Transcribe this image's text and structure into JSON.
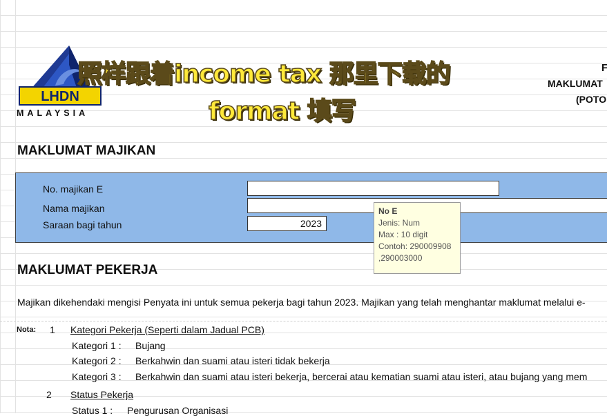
{
  "overlay": {
    "line1": "照样跟着income tax 那里下载的",
    "line2": "format 填写"
  },
  "logo": {
    "name": "LHDN",
    "country": "MALAYSIA"
  },
  "header_right": {
    "line1": "F",
    "line2": "MAKLUMAT",
    "line3": "(POTO"
  },
  "majikan": {
    "title": "MAKLUMAT MAJIKAN",
    "no_majikan_label": "No. majikan E",
    "nama_majikan_label": "Nama majikan",
    "saraan_label": "Saraan bagi tahun",
    "no_majikan_value": "",
    "nama_majikan_value": "",
    "saraan_value": "2023"
  },
  "tooltip": {
    "title": "No E",
    "line1": "Jenis: Num",
    "line2": "Max : 10 digit",
    "line3": "Contoh: 290009908",
    "line4": ",290003000"
  },
  "pekerja": {
    "title": "MAKLUMAT PEKERJA",
    "intro": "Majikan dikehendaki mengisi Penyata ini untuk semua pekerja bagi tahun 2023. Majikan yang telah menghantar maklumat melalui e-"
  },
  "nota": {
    "label": "Nota:",
    "item1_num": "1",
    "item1_title": "Kategori Pekerja (Seperti dalam Jadual PCB)",
    "k1_label": "Kategori 1 :",
    "k1_text": "Bujang",
    "k2_label": "Kategori 2 :",
    "k2_text": "Berkahwin dan suami atau isteri tidak bekerja",
    "k3_label": "Kategori 3 :",
    "k3_text": "Berkahwin dan suami atau isteri bekerja, bercerai atau kematian suami atau isteri, atau bujang yang mem",
    "item2_num": "2",
    "item2_title": "Status Pekerja",
    "s1_label": "Status 1 :",
    "s1_text": "Pengurusan Organisasi"
  }
}
